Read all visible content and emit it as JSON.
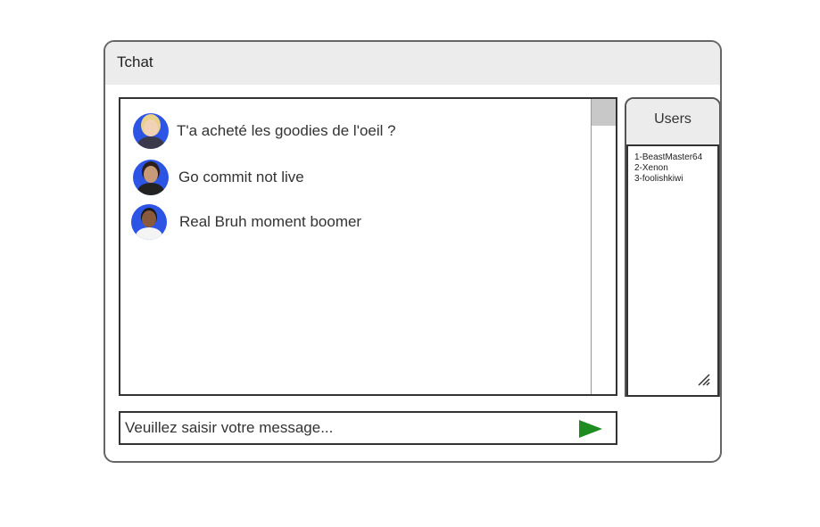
{
  "window": {
    "title": "Tchat"
  },
  "chat": {
    "messages": [
      {
        "avatar": "blonde-woman-avatar",
        "text": "T'a acheté les goodies de l'oeil ?"
      },
      {
        "avatar": "dark-haired-man-avatar",
        "text": "Go commit not live"
      },
      {
        "avatar": "smiling-man-avatar",
        "text": "Real Bruh moment boomer"
      }
    ]
  },
  "users": {
    "header": "Users",
    "list": [
      "1-BeastMaster64",
      "2-Xenon",
      "3-foolishkiwi"
    ]
  },
  "composer": {
    "placeholder": "Veuillez saisir votre message...",
    "send_icon": "play-triangle-icon"
  },
  "colors": {
    "avatar_bg": "#2c55e6",
    "send_icon": "#1f8c1f",
    "titlebar_bg": "#ececec"
  }
}
